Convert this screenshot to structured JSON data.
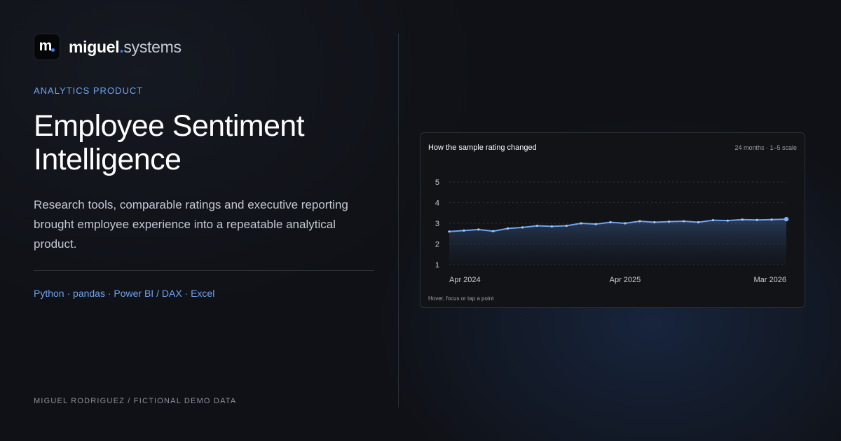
{
  "brand": {
    "logo_letter": "m",
    "name_a": "miguel",
    "name_dot": ".",
    "name_b": "systems"
  },
  "eyebrow": "ANALYTICS PRODUCT",
  "title_line1": "Employee Sentiment",
  "title_line2": "Intelligence",
  "description": "Research tools, comparable ratings and executive reporting brought employee experience into a repeatable analytical product.",
  "tags": "Python · pandas · Power BI / DAX · Excel",
  "footer": "MIGUEL RODRIGUEZ / FICTIONAL DEMO DATA",
  "colors": {
    "background": "#0f1116",
    "accent": "#6ea3ee",
    "brand_dot": "#3b82f6",
    "line": "#6ea3ee"
  },
  "card": {
    "title": "How the sample rating changed",
    "meta": "24 months · 1–5 scale",
    "hint": "Hover, focus or tap a point"
  },
  "chart_data": {
    "type": "area",
    "ylim": [
      1,
      5
    ],
    "y_ticks": [
      1,
      2,
      3,
      4,
      5
    ],
    "x_tick_labels": [
      "Apr 2024",
      "Apr 2025",
      "Mar 2026"
    ],
    "x_tick_indices": [
      0,
      12,
      23
    ],
    "grid": true,
    "values": [
      2.6,
      2.65,
      2.7,
      2.62,
      2.75,
      2.8,
      2.88,
      2.85,
      2.88,
      3.0,
      2.96,
      3.05,
      3.0,
      3.1,
      3.05,
      3.08,
      3.1,
      3.05,
      3.15,
      3.13,
      3.18,
      3.16,
      3.18,
      3.2
    ]
  }
}
